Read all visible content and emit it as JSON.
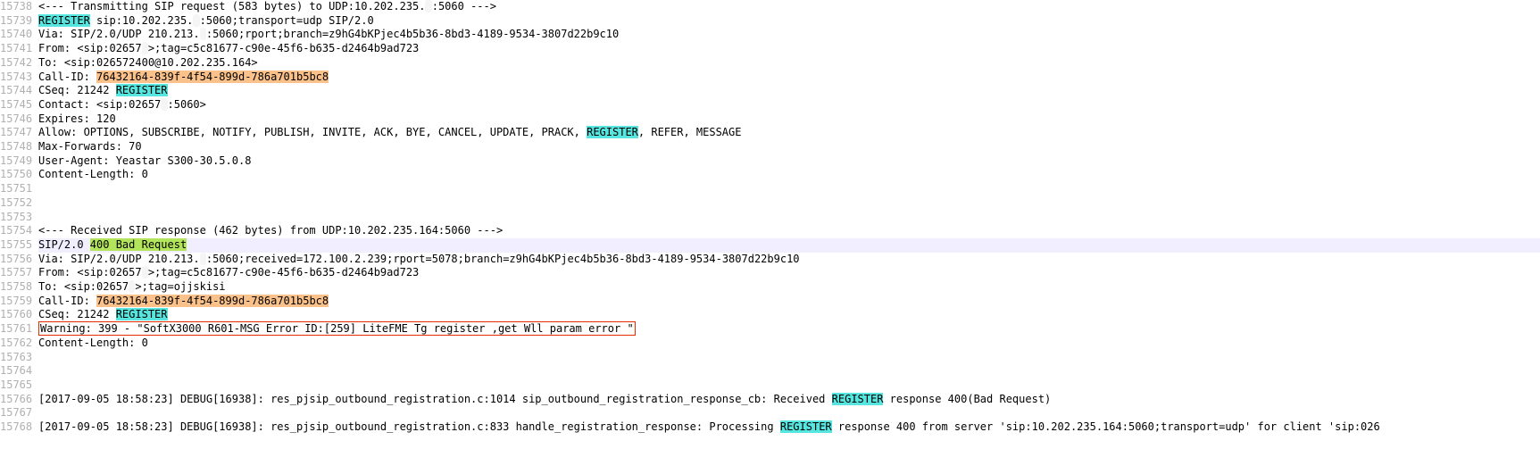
{
  "lines": [
    {
      "n": 15738,
      "hl": false,
      "segs": [
        {
          "t": "<--- Transmitting SIP request (583 bytes) to UDP:10.202.235."
        },
        {
          "t": "   ",
          "cls": "smudge"
        },
        {
          "t": ":5060 --->"
        }
      ]
    },
    {
      "n": 15739,
      "hl": false,
      "segs": [
        {
          "t": "REGISTER",
          "cls": "hi-cyan"
        },
        {
          "t": " sip:10.202.235."
        },
        {
          "t": "   ",
          "cls": "smudge"
        },
        {
          "t": ":5060;transport=udp SIP/2.0"
        }
      ]
    },
    {
      "n": 15740,
      "hl": false,
      "segs": [
        {
          "t": "Via: SIP/2.0/UDP 210.213."
        },
        {
          "t": "      ",
          "cls": "smudge"
        },
        {
          "t": ":5060;rport;branch=z9hG4bKPjec4b5b36-8bd3-4189-9534-3807d22b9c10"
        }
      ]
    },
    {
      "n": 15741,
      "hl": false,
      "segs": [
        {
          "t": "From: <sip:02657"
        },
        {
          "t": "               ",
          "cls": "smudge"
        },
        {
          "t": ">;tag=c5c81677-c90e-45f6-b635-d2464b9ad723"
        }
      ]
    },
    {
      "n": 15742,
      "hl": false,
      "segs": [
        {
          "t": "To: <sip:026572400@10.202.235.164>"
        }
      ]
    },
    {
      "n": 15743,
      "hl": false,
      "segs": [
        {
          "t": "Call-ID: "
        },
        {
          "t": "76432164-839f-4f54-899d-786a701b5bc8",
          "cls": "hi-orange"
        }
      ]
    },
    {
      "n": 15744,
      "hl": false,
      "segs": [
        {
          "t": "CSeq: 21242 "
        },
        {
          "t": "REGISTER",
          "cls": "hi-cyan"
        }
      ]
    },
    {
      "n": 15745,
      "hl": false,
      "segs": [
        {
          "t": "Contact: <sip:02657"
        },
        {
          "t": "                   ",
          "cls": "smudge"
        },
        {
          "t": ":5060>"
        }
      ]
    },
    {
      "n": 15746,
      "hl": false,
      "segs": [
        {
          "t": "Expires: 120"
        }
      ]
    },
    {
      "n": 15747,
      "hl": false,
      "segs": [
        {
          "t": "Allow: OPTIONS, SUBSCRIBE, NOTIFY, PUBLISH, INVITE, ACK, BYE, CANCEL, UPDATE, PRACK, "
        },
        {
          "t": "REGISTER",
          "cls": "hi-cyan"
        },
        {
          "t": ", REFER, MESSAGE"
        }
      ]
    },
    {
      "n": 15748,
      "hl": false,
      "segs": [
        {
          "t": "Max-Forwards: 70"
        }
      ]
    },
    {
      "n": 15749,
      "hl": false,
      "segs": [
        {
          "t": "User-Agent: Yeastar S300-30.5.0.8"
        }
      ]
    },
    {
      "n": 15750,
      "hl": false,
      "segs": [
        {
          "t": "Content-Length:  0"
        }
      ]
    },
    {
      "n": 15751,
      "hl": false,
      "segs": [
        {
          "t": " "
        }
      ]
    },
    {
      "n": 15752,
      "hl": false,
      "segs": [
        {
          "t": " "
        }
      ]
    },
    {
      "n": 15753,
      "hl": false,
      "segs": [
        {
          "t": " "
        }
      ]
    },
    {
      "n": 15754,
      "hl": false,
      "segs": [
        {
          "t": "<--- Received SIP response (462 bytes) from UDP:10.202.235.164:5060 --->"
        }
      ]
    },
    {
      "n": 15755,
      "hl": true,
      "segs": [
        {
          "t": "SIP/2.0 "
        },
        {
          "t": "400 Bad Request",
          "cls": "hi-yellowgreen"
        }
      ]
    },
    {
      "n": 15756,
      "hl": false,
      "segs": [
        {
          "t": "Via: SIP/2.0/UDP 210.213."
        },
        {
          "t": "      ",
          "cls": "smudge"
        },
        {
          "t": ":5060;received=172.100.2.239;rport=5078;branch=z9hG4bKPjec4b5b36-8bd3-4189-9534-3807d22b9c10"
        }
      ]
    },
    {
      "n": 15757,
      "hl": false,
      "segs": [
        {
          "t": "From: <sip:02657"
        },
        {
          "t": "               ",
          "cls": "smudge"
        },
        {
          "t": ">;tag=c5c81677-c90e-45f6-b635-d2464b9ad723"
        }
      ]
    },
    {
      "n": 15758,
      "hl": false,
      "segs": [
        {
          "t": "To: <sip:02657"
        },
        {
          "t": "                 ",
          "cls": "smudge"
        },
        {
          "t": ">;tag=ojjskisi"
        }
      ]
    },
    {
      "n": 15759,
      "hl": false,
      "segs": [
        {
          "t": "Call-ID: "
        },
        {
          "t": "76432164-839f-4f54-899d-786a701b5bc8",
          "cls": "hi-orange"
        }
      ]
    },
    {
      "n": 15760,
      "hl": false,
      "segs": [
        {
          "t": "CSeq: 21242 "
        },
        {
          "t": "REGISTER",
          "cls": "hi-cyan"
        }
      ]
    },
    {
      "n": 15761,
      "hl": false,
      "segs": [
        {
          "t": "Warning: 399 - \"SoftX3000 R601-MSG Error ID:[259] LiteFME Tg register ,get Wll param error \"",
          "cls": "boxed"
        }
      ]
    },
    {
      "n": 15762,
      "hl": false,
      "segs": [
        {
          "t": "Content-Length: 0"
        }
      ]
    },
    {
      "n": 15763,
      "hl": false,
      "segs": [
        {
          "t": " "
        }
      ]
    },
    {
      "n": 15764,
      "hl": false,
      "segs": [
        {
          "t": " "
        }
      ]
    },
    {
      "n": 15765,
      "hl": false,
      "segs": [
        {
          "t": " "
        }
      ]
    },
    {
      "n": 15766,
      "hl": false,
      "segs": [
        {
          "t": "[2017-09-05 18:58:23] DEBUG[16938]:   res_pjsip_outbound_registration.c:1014 sip_outbound_registration_response_cb: Received "
        },
        {
          "t": "REGISTER",
          "cls": "hi-cyan"
        },
        {
          "t": " response 400(Bad Request)"
        }
      ]
    },
    {
      "n": 15767,
      "hl": false,
      "segs": [
        {
          "t": " "
        }
      ]
    },
    {
      "n": 15768,
      "hl": false,
      "segs": [
        {
          "t": "[2017-09-05 18:58:23] DEBUG[16938]:   res_pjsip_outbound_registration.c:833 handle_registration_response: Processing "
        },
        {
          "t": "REGISTER",
          "cls": "hi-cyan"
        },
        {
          "t": " response 400 from server 'sip:10.202.235.164:5060;transport=udp' for client 'sip:026"
        }
      ]
    }
  ]
}
